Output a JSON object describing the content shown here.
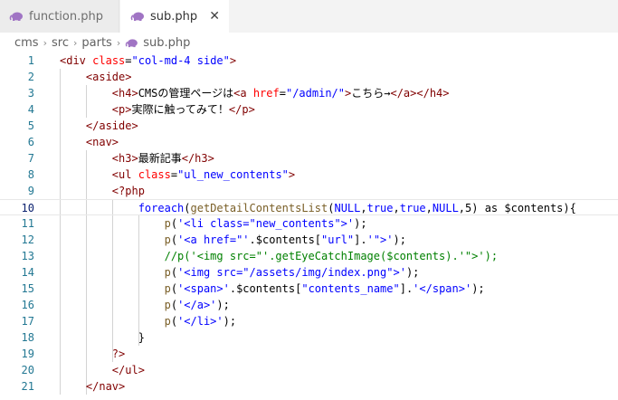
{
  "tabs": [
    {
      "label": "function.php",
      "icon": "php-elephant-icon",
      "active": false
    },
    {
      "label": "sub.php",
      "icon": "php-elephant-icon",
      "active": true,
      "close": "✕"
    }
  ],
  "breadcrumb": [
    "cms",
    "src",
    "parts",
    "sub.php"
  ],
  "breadcrumb_separator": "›",
  "colors": {
    "tag": "#800000",
    "attr": "#ff0000",
    "string": "#0000ff",
    "keyword": "#0000ff",
    "func": "#795e26",
    "comment": "#008000",
    "plain": "#000000",
    "line_number": "#237893"
  },
  "editor": {
    "active_line": 10,
    "lines": [
      {
        "n": "1",
        "tokens": [
          [
            "tag",
            "<div"
          ],
          [
            "plain",
            " "
          ],
          [
            "attr",
            "class"
          ],
          [
            "plain",
            "="
          ],
          [
            "string",
            "\"col-md-4 side\""
          ],
          [
            "tag",
            ">"
          ]
        ]
      },
      {
        "n": "2",
        "tokens": [
          [
            "plain",
            "    "
          ],
          [
            "tag",
            "<aside>"
          ]
        ]
      },
      {
        "n": "3",
        "tokens": [
          [
            "plain",
            "        "
          ],
          [
            "tag",
            "<h4>"
          ],
          [
            "plain",
            "CMSの管理ページは"
          ],
          [
            "tag",
            "<a"
          ],
          [
            "plain",
            " "
          ],
          [
            "attr",
            "href"
          ],
          [
            "plain",
            "="
          ],
          [
            "string",
            "\"/admin/\""
          ],
          [
            "tag",
            ">"
          ],
          [
            "plain",
            "こちら→"
          ],
          [
            "tag",
            "</a></h4>"
          ]
        ]
      },
      {
        "n": "4",
        "tokens": [
          [
            "plain",
            "        "
          ],
          [
            "tag",
            "<p>"
          ],
          [
            "plain",
            "実際に触ってみて！"
          ],
          [
            "tag",
            "</p>"
          ]
        ]
      },
      {
        "n": "5",
        "tokens": [
          [
            "plain",
            "    "
          ],
          [
            "tag",
            "</aside>"
          ]
        ]
      },
      {
        "n": "6",
        "tokens": [
          [
            "plain",
            "    "
          ],
          [
            "tag",
            "<nav>"
          ]
        ]
      },
      {
        "n": "7",
        "tokens": [
          [
            "plain",
            "        "
          ],
          [
            "tag",
            "<h3>"
          ],
          [
            "plain",
            "最新記事"
          ],
          [
            "tag",
            "</h3>"
          ]
        ]
      },
      {
        "n": "8",
        "tokens": [
          [
            "plain",
            "        "
          ],
          [
            "tag",
            "<ul"
          ],
          [
            "plain",
            " "
          ],
          [
            "attr",
            "class"
          ],
          [
            "plain",
            "="
          ],
          [
            "string",
            "\"ul_new_contents\""
          ],
          [
            "tag",
            ">"
          ]
        ]
      },
      {
        "n": "9",
        "tokens": [
          [
            "plain",
            "        "
          ],
          [
            "tag",
            "<?php"
          ]
        ]
      },
      {
        "n": "10",
        "tokens": [
          [
            "plain",
            "            "
          ],
          [
            "keyword",
            "foreach"
          ],
          [
            "plain",
            "("
          ],
          [
            "func",
            "getDetailContentsList"
          ],
          [
            "plain",
            "("
          ],
          [
            "keyword",
            "NULL"
          ],
          [
            "plain",
            ","
          ],
          [
            "keyword",
            "true"
          ],
          [
            "plain",
            ","
          ],
          [
            "keyword",
            "true"
          ],
          [
            "plain",
            ","
          ],
          [
            "keyword",
            "NULL"
          ],
          [
            "plain",
            ",5) as $contents){"
          ]
        ]
      },
      {
        "n": "11",
        "tokens": [
          [
            "plain",
            "                "
          ],
          [
            "func",
            "p"
          ],
          [
            "plain",
            "("
          ],
          [
            "string",
            "'<li class=\"new_contents\">'"
          ],
          [
            "plain",
            ");"
          ]
        ]
      },
      {
        "n": "12",
        "tokens": [
          [
            "plain",
            "                "
          ],
          [
            "func",
            "p"
          ],
          [
            "plain",
            "("
          ],
          [
            "string",
            "'<a href=\"'"
          ],
          [
            "plain",
            ".$contents["
          ],
          [
            "string",
            "\"url\""
          ],
          [
            "plain",
            "]."
          ],
          [
            "string",
            "'\">'"
          ],
          [
            "plain",
            ");"
          ]
        ]
      },
      {
        "n": "13",
        "tokens": [
          [
            "plain",
            "                "
          ],
          [
            "comment",
            "//p('<img src=\"'.getEyeCatchImage($contents).'\">');"
          ]
        ]
      },
      {
        "n": "14",
        "tokens": [
          [
            "plain",
            "                "
          ],
          [
            "func",
            "p"
          ],
          [
            "plain",
            "("
          ],
          [
            "string",
            "'<img src=\"/assets/img/index.png\">'"
          ],
          [
            "plain",
            ");"
          ]
        ]
      },
      {
        "n": "15",
        "tokens": [
          [
            "plain",
            "                "
          ],
          [
            "func",
            "p"
          ],
          [
            "plain",
            "("
          ],
          [
            "string",
            "'<span>'"
          ],
          [
            "plain",
            ".$contents["
          ],
          [
            "string",
            "\"contents_name\""
          ],
          [
            "plain",
            "]."
          ],
          [
            "string",
            "'</span>'"
          ],
          [
            "plain",
            ");"
          ]
        ]
      },
      {
        "n": "16",
        "tokens": [
          [
            "plain",
            "                "
          ],
          [
            "func",
            "p"
          ],
          [
            "plain",
            "("
          ],
          [
            "string",
            "'</a>'"
          ],
          [
            "plain",
            ");"
          ]
        ]
      },
      {
        "n": "17",
        "tokens": [
          [
            "plain",
            "                "
          ],
          [
            "func",
            "p"
          ],
          [
            "plain",
            "("
          ],
          [
            "string",
            "'</li>'"
          ],
          [
            "plain",
            ");"
          ]
        ]
      },
      {
        "n": "18",
        "tokens": [
          [
            "plain",
            "            }"
          ]
        ]
      },
      {
        "n": "19",
        "tokens": [
          [
            "plain",
            "        "
          ],
          [
            "tag",
            "?>"
          ]
        ]
      },
      {
        "n": "20",
        "tokens": [
          [
            "plain",
            "        "
          ],
          [
            "tag",
            "</ul>"
          ]
        ]
      },
      {
        "n": "21",
        "tokens": [
          [
            "plain",
            "    "
          ],
          [
            "tag",
            "</nav>"
          ]
        ]
      }
    ]
  }
}
